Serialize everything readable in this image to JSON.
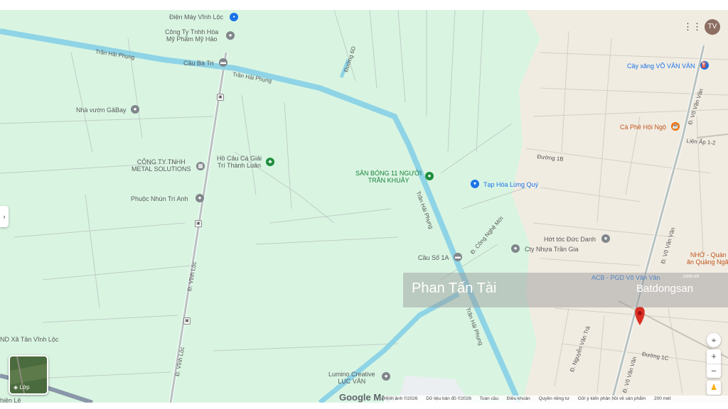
{
  "map": {
    "places": {
      "dien_may": "Điện Máy Vĩnh Lộc",
      "my_pham_1": "Công Ty Tnhh Hóa",
      "my_pham_2": "Mỹ Phẩm Mỹ Hảo",
      "cau_ba_tri": "Cầu Bà Tri",
      "nha_vuon": "Nhà vườn GâBay",
      "cty_metal_1": "CÔNG TY TNHH",
      "cty_metal_2": "METAL SOLUTIONS",
      "ho_cau_1": "Hồ Câu Cá Giải",
      "ho_cau_2": "Trí Thành Luân",
      "san_bong_1": "SÂN BÓNG 11 NGƯỜI",
      "san_bong_2": "TRẦN KHUÂY",
      "tap_hoa": "Tạp Hóa Lừng Quý",
      "phuoc_nhun": "Phuộc Nhún Trí Anh",
      "cay_xang": "Cây xăng VÕ VĂN VÂN",
      "ca_phe": "Cà Phê Hội Ngộ",
      "hot_toc": "Hớt tóc Đức Danh",
      "cty_nhua": "Cty Nhựa Trần Gia",
      "cau_so": "Cầu Số 1A",
      "acb": "ACB - PGD Võ Văn Vân",
      "nho_quan_1": "NHỚ - Quán",
      "nho_quan_2": "ăn Quảng Ngãi",
      "lumino_1": "Lumino Creative",
      "lumino_2": "LỤC VÂN",
      "ubnd": "ND Xã Tân Vĩnh Lộc",
      "hien_le": "hiện Lệ"
    },
    "roads": {
      "tran_hai_phung": "Trần Hải Phụng",
      "duong_6d": "Đường 6D",
      "duong_1b": "Đường 1B",
      "duong_1c": "Đường 1C",
      "lien_ap": "Liên Ấp 1-2",
      "vinh_loc": "Đ. Vĩnh Lộc",
      "vo_van_van": "Đ. Võ Văn Vân",
      "cong_nghe_moi": "Đ. Công Nghệ Mới",
      "nguyen_van_tra": "Đ. Nguyễn Văn Trà"
    },
    "colors": {
      "background": "#d9f5e2",
      "urban": "#f1ece2",
      "canal": "#8fd4e6",
      "road": "#b8c2c0",
      "pin": "#d93025"
    }
  },
  "watermark": {
    "name": "Phan Tấn Tài",
    "brand": "Batdongsan",
    "domain": ".com.vn"
  },
  "controls": {
    "avatar": "TV",
    "layer_label": "Lớp",
    "zoom_in": "+",
    "zoom_out": "−",
    "expand": "›"
  },
  "logo": "Google Maps",
  "attribution": {
    "imagery": "Hình ảnh ©2026",
    "map_data": "Dữ liệu bản đồ ©2026",
    "global": "Toàn cầu",
    "terms": "Điều khoản",
    "privacy": "Quyền riêng tư",
    "feedback": "Gửi ý kiến phản hồi về sản phẩm",
    "scale": "200 mét"
  }
}
